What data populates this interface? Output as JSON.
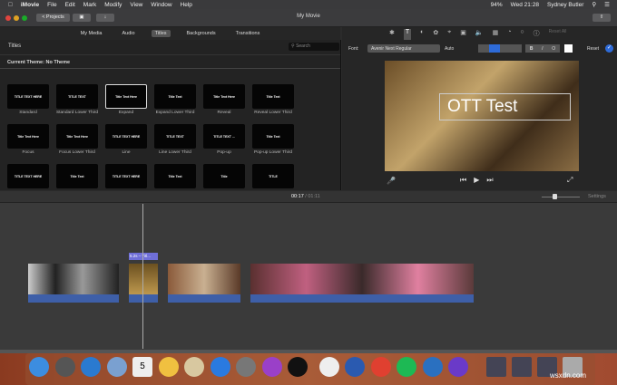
{
  "menubar": {
    "apple": "",
    "app": "iMovie",
    "items": [
      "File",
      "Edit",
      "Mark",
      "Modify",
      "View",
      "Window",
      "Help"
    ],
    "battery": "94%",
    "clock": "Wed 21:28",
    "user": "Sydney Butler"
  },
  "toolbar": {
    "projects": "< Projects",
    "title": "My Movie"
  },
  "tabs": [
    "My Media",
    "Audio",
    "Titles",
    "Backgrounds",
    "Transitions"
  ],
  "browser": {
    "heading": "Titles",
    "search_placeholder": "Search",
    "theme": "Current Theme: No Theme",
    "tiles": [
      {
        "label": "Standard",
        "text": "TITLE TEXT HERE"
      },
      {
        "label": "Standard Lower Third",
        "text": "TITLE TEXT"
      },
      {
        "label": "Expand",
        "text": "Title Text Here"
      },
      {
        "label": "Expand Lower Third",
        "text": "Title Text"
      },
      {
        "label": "Reveal",
        "text": "Title Text Here"
      },
      {
        "label": "Reveal Lower Third",
        "text": "Title Text"
      },
      {
        "label": "Focus",
        "text": "Title Text Here"
      },
      {
        "label": "Focus Lower Third",
        "text": "Title Text Here"
      },
      {
        "label": "Line",
        "text": "TITLE TEXT HERE"
      },
      {
        "label": "Line Lower Third",
        "text": "TITLE TEXT"
      },
      {
        "label": "Pop-up",
        "text": "TITLE TEXT ..."
      },
      {
        "label": "Pop-up Lower Third",
        "text": "Title Text"
      },
      {
        "label": "",
        "text": "TITLE TEXT HERE"
      },
      {
        "label": "",
        "text": "Title Text"
      },
      {
        "label": "",
        "text": "TITLE TEXT HERE"
      },
      {
        "label": "",
        "text": "Title Text"
      },
      {
        "label": "",
        "text": "Title"
      },
      {
        "label": "",
        "text": "TITLE"
      }
    ]
  },
  "viewer": {
    "font_label": "Font:",
    "font": "Avenir Next Regular",
    "size": "Auto",
    "reset": "Reset",
    "reset_all": "Reset All",
    "overlay_title": "OTT Test"
  },
  "timeline": {
    "current": "00:17",
    "total": "01:11",
    "separator": "/",
    "settings": "Settings",
    "title_clip": "5.2s – Titl..."
  },
  "dock": {
    "watermark": "wsxdn.com",
    "calendar_day": "5",
    "apps": [
      "Finder",
      "Launchpad",
      "Safari",
      "Preview",
      "Calendar",
      "Photos",
      "TextEdit",
      "App Store",
      "System Preferences",
      "Podcasts",
      "Apple TV",
      "Slack",
      "Word",
      "Chrome",
      "Spotify",
      "Trello",
      "iMovie"
    ]
  }
}
